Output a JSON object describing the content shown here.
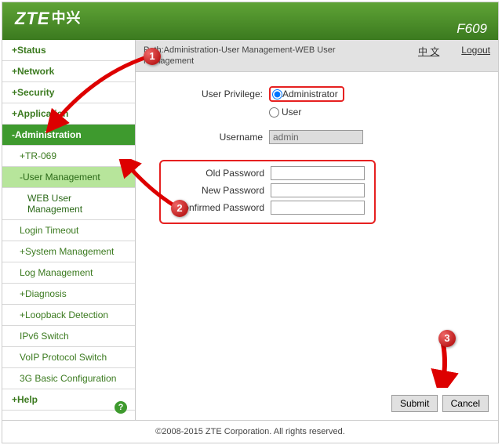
{
  "header": {
    "logo": "ZTE",
    "logo_cn": "中兴",
    "model": "F609"
  },
  "sidebar": {
    "items": [
      {
        "label": "+Status"
      },
      {
        "label": "+Network"
      },
      {
        "label": "+Security"
      },
      {
        "label": "+Application"
      },
      {
        "label": "-Administration",
        "active": true
      },
      {
        "label": "+TR-069",
        "sub": true
      },
      {
        "label": "-User Management",
        "sub": true,
        "selected": true
      },
      {
        "label": "WEB User Management",
        "sub2": true
      },
      {
        "label": "Login Timeout",
        "sub": true
      },
      {
        "label": "+System Management",
        "sub": true
      },
      {
        "label": "Log Management",
        "sub": true
      },
      {
        "label": "+Diagnosis",
        "sub": true
      },
      {
        "label": "+Loopback Detection",
        "sub": true
      },
      {
        "label": "IPv6 Switch",
        "sub": true
      },
      {
        "label": "VoIP Protocol Switch",
        "sub": true
      },
      {
        "label": "3G Basic Configuration",
        "sub": true
      },
      {
        "label": "+Help"
      }
    ]
  },
  "path": {
    "text": "Path:Administration-User Management-WEB User Management",
    "lang": "中 文",
    "logout": "Logout"
  },
  "form": {
    "privilege_label": "User Privilege:",
    "priv_admin": "Administrator",
    "priv_user": "User",
    "username_label": "Username",
    "username_value": "admin",
    "oldpw_label": "Old Password",
    "newpw_label": "New Password",
    "confpw_label": "Confirmed Password"
  },
  "buttons": {
    "submit": "Submit",
    "cancel": "Cancel"
  },
  "footer": "©2008-2015 ZTE Corporation. All rights reserved.",
  "callouts": {
    "c1": "1",
    "c2": "2",
    "c3": "3"
  }
}
